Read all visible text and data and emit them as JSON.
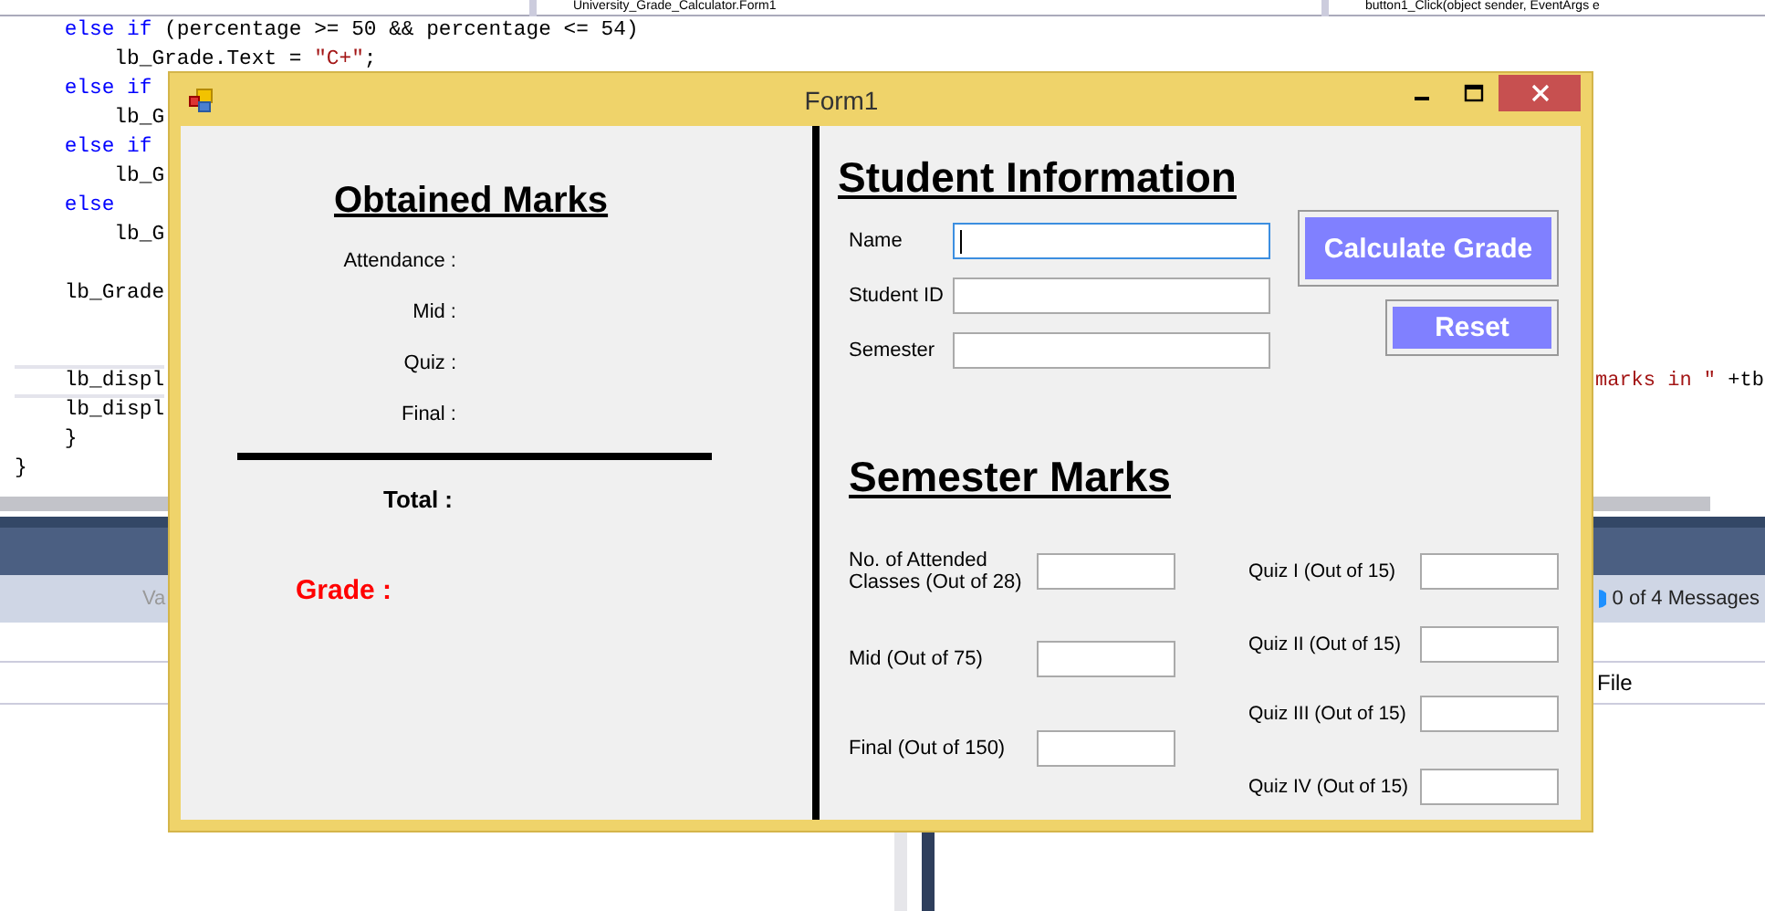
{
  "ide": {
    "tabs": [
      "University_Grade_Calculator.Form1",
      "button1_Click(object sender, EventArgs e"
    ],
    "code_blocks": [
      {
        "lines": [
          {
            "tokens": [
              {
                "kind": "keyword",
                "text": "    else if"
              },
              {
                "kind": "plain",
                "text": " (percentage >= 50 && percentage <= 54)"
              }
            ]
          },
          {
            "tokens": [
              {
                "kind": "plain",
                "text": "        lb_Grade.Text = "
              },
              {
                "kind": "string",
                "text": "\"C+\""
              },
              {
                "kind": "plain",
                "text": ";"
              }
            ]
          },
          {
            "tokens": [
              {
                "kind": "keyword",
                "text": "    else if"
              }
            ]
          },
          {
            "tokens": [
              {
                "kind": "plain",
                "text": "        lb_G"
              }
            ]
          },
          {
            "tokens": [
              {
                "kind": "keyword",
                "text": "    else if"
              }
            ]
          },
          {
            "tokens": [
              {
                "kind": "plain",
                "text": "        lb_G"
              }
            ]
          },
          {
            "tokens": [
              {
                "kind": "keyword",
                "text": "    else"
              }
            ]
          },
          {
            "tokens": [
              {
                "kind": "plain",
                "text": "        lb_G"
              }
            ]
          }
        ]
      },
      {
        "lines": [
          {
            "tokens": [
              {
                "kind": "plain",
                "text": "    lb_Grade"
              }
            ]
          }
        ]
      },
      {
        "lines": [
          {
            "current": true,
            "tokens": [
              {
                "kind": "plain",
                "text": "    lb_displ"
              }
            ]
          },
          {
            "current": false,
            "tokens": [
              {
                "kind": "plain",
                "text": "    lb_displ"
              }
            ]
          },
          {
            "tokens": [
              {
                "kind": "plain",
                "text": "    }"
              }
            ]
          },
          {
            "tokens": [
              {
                "kind": "plain",
                "text": "}"
              }
            ]
          }
        ]
      }
    ],
    "side_code": [
      {
        "kind": "string",
        "text": "marks in \""
      },
      {
        "kind": "plain",
        "text": " +tb"
      }
    ],
    "panel": {
      "column_2": "Va",
      "messages": "0 of 4 Messages",
      "row_item": "File"
    }
  },
  "form": {
    "title": "Form1",
    "obtained": {
      "heading": "Obtained Marks",
      "rows": [
        "Attendance :",
        "Mid :",
        "Quiz :",
        "Final :"
      ],
      "total": "Total :",
      "grade": "Grade :"
    },
    "student_info": {
      "heading": "Student Information",
      "fields": [
        {
          "label": "Name",
          "focused": true
        },
        {
          "label": "Student ID",
          "focused": false
        },
        {
          "label": "Semester",
          "focused": false
        }
      ]
    },
    "buttons": [
      "Calculate Grade",
      "Reset"
    ],
    "semester_marks": {
      "heading": "Semester Marks",
      "left": [
        "No. of Attended Classes (Out of 28)",
        "Mid (Out of 75)",
        "Final (Out of 150)"
      ],
      "right": [
        "Quiz I (Out of 15)",
        "Quiz II (Out of 15)",
        "Quiz III (Out of 15)",
        "Quiz IV (Out of 15)"
      ]
    }
  }
}
